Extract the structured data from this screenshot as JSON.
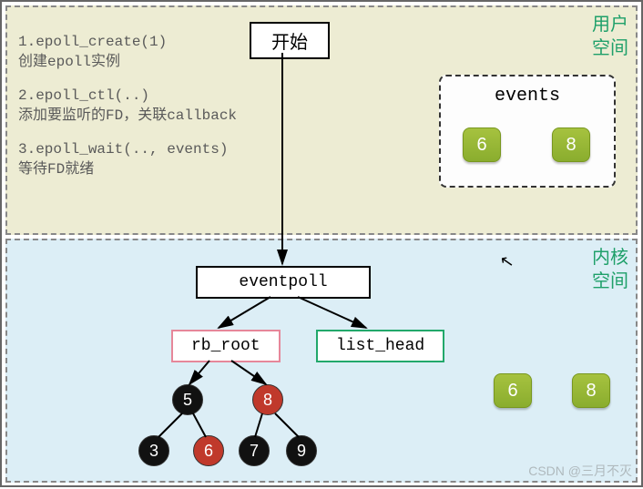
{
  "zones": {
    "user_label_l1": "用户",
    "user_label_l2": "空间",
    "kernel_label_l1": "内核",
    "kernel_label_l2": "空间"
  },
  "start_label": "开始",
  "steps": {
    "s1_code": "1.epoll_create(1)",
    "s1_desc": "创建epoll实例",
    "s2_code": "2.epoll_ctl(..)",
    "s2_desc": "添加要监听的FD，关联callback",
    "s3_code": "3.epoll_wait(.., events)",
    "s3_desc": "等待FD就绪"
  },
  "events": {
    "title": "events",
    "items": [
      "6",
      "8"
    ]
  },
  "kernel": {
    "eventpoll": "eventpoll",
    "rb_root": "rb_root",
    "list_head": "list_head",
    "ready_list": [
      "6",
      "8"
    ],
    "rbtree": {
      "n5": "5",
      "n8": "8",
      "n3": "3",
      "n6": "6",
      "n7": "7",
      "n9": "9"
    }
  },
  "watermark": "CSDN @三月不灭",
  "colors": {
    "user_bg": "#edecd3",
    "kernel_bg": "#dceef6",
    "chip": "#8aad2e",
    "rb_border": "#e6879a",
    "list_border": "#22a86b"
  }
}
